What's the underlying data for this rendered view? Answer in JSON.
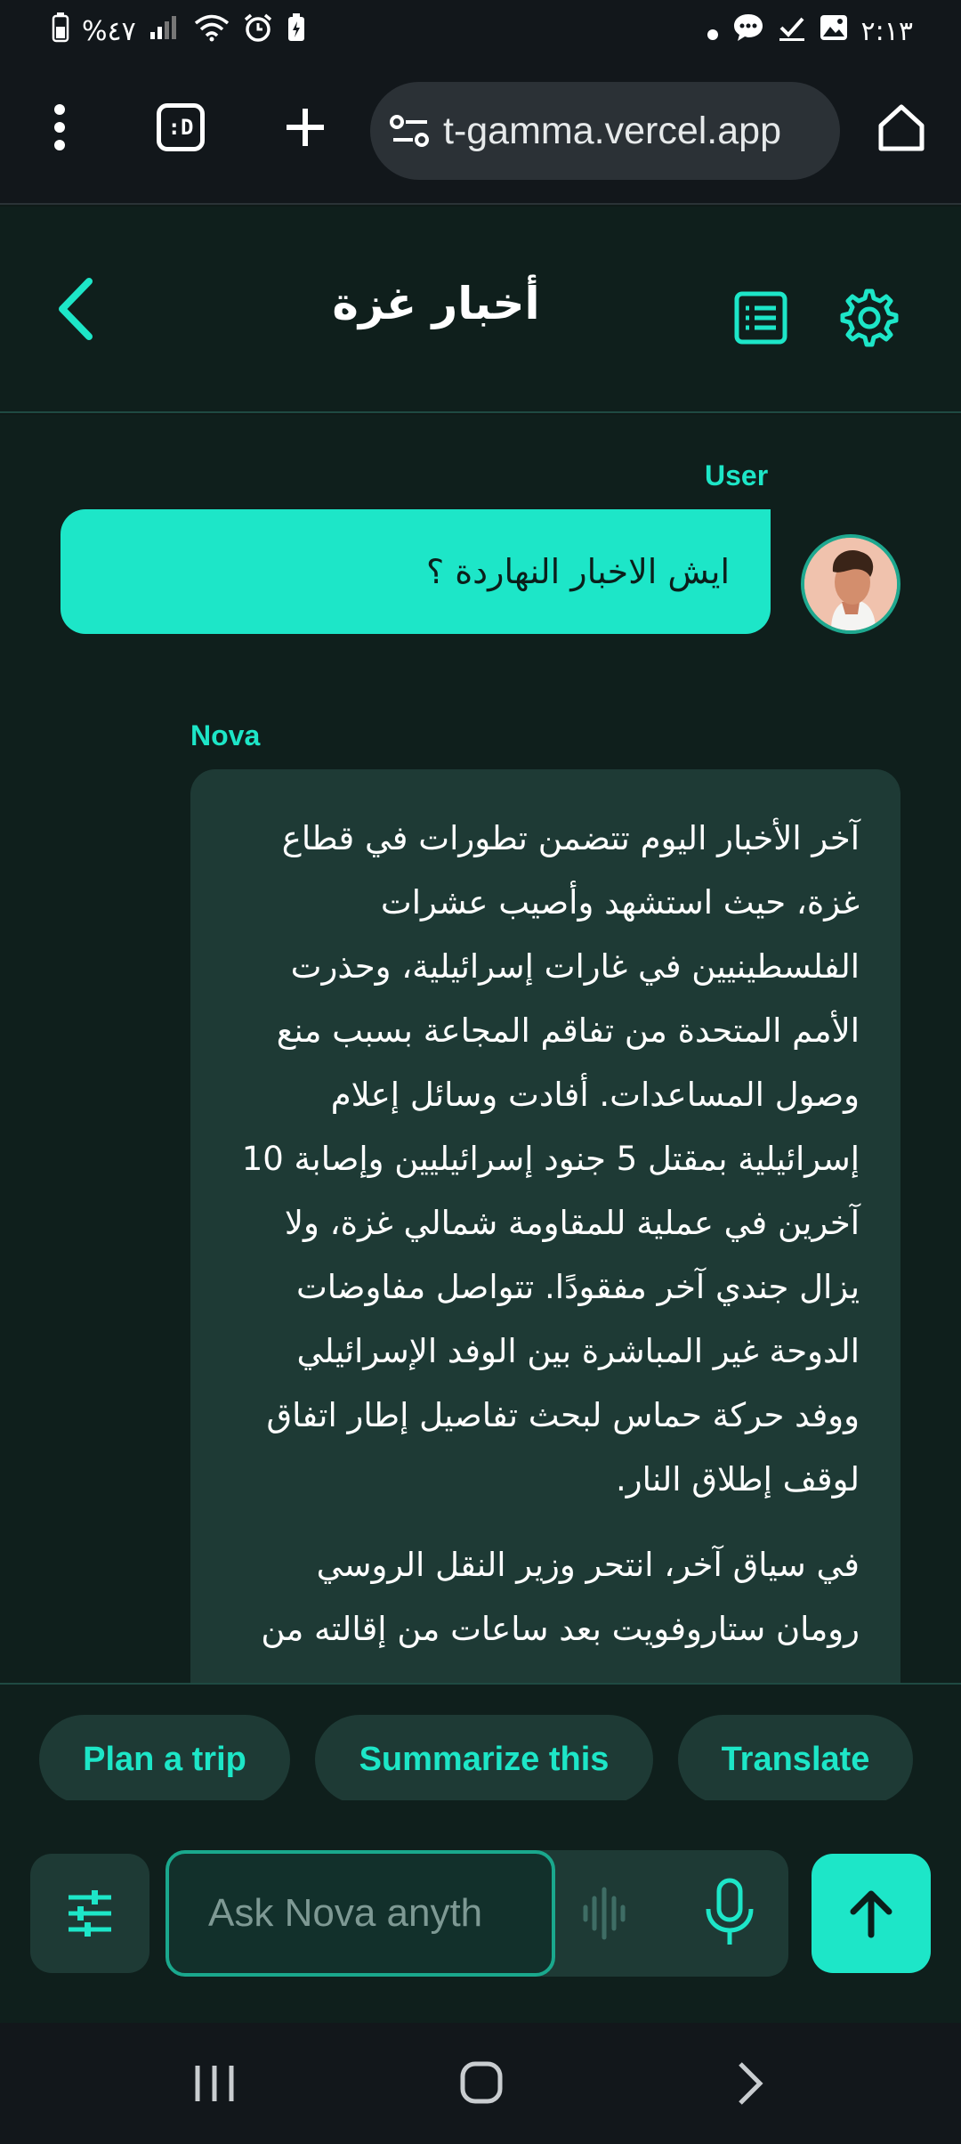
{
  "status_bar": {
    "battery": "%٤٧",
    "time": "٢:١٣"
  },
  "browser": {
    "url": "t-gamma.vercel.app",
    "tab_icon_label": ":D"
  },
  "header": {
    "title": "أخبار غزة"
  },
  "chat": {
    "user_label": "User",
    "user_message": "ايش الاخبار النهاردة ؟",
    "assistant_label": "Nova",
    "assistant_paragraphs": [
      "آخر الأخبار اليوم تتضمن تطورات في قطاع غزة، حيث استشهد وأصيب عشرات الفلسطينيين في غارات إسرائيلية، وحذرت الأمم المتحدة من تفاقم المجاعة بسبب منع وصول المساعدات. أفادت وسائل إعلام إسرائيلية بمقتل 5 جنود إسرائيليين وإصابة 10 آخرين في عملية للمقاومة شمالي غزة، ولا يزال جندي آخر مفقودًا. تتواصل مفاوضات الدوحة غير المباشرة بين الوفد الإسرائيلي ووفد حركة حماس لبحث تفاصيل إطار اتفاق لوقف إطلاق النار.",
      "في سياق آخر، انتحر وزير النقل الروسي رومان ستاروفويت بعد ساعات من إقالته من"
    ]
  },
  "suggestions": [
    "Plan a trip",
    "Summarize this",
    "Translate"
  ],
  "input": {
    "placeholder": "Ask Nova anyth"
  },
  "colors": {
    "accent": "#1de6c8",
    "background": "#0f1f1c",
    "bubble": "#1e3a35"
  }
}
